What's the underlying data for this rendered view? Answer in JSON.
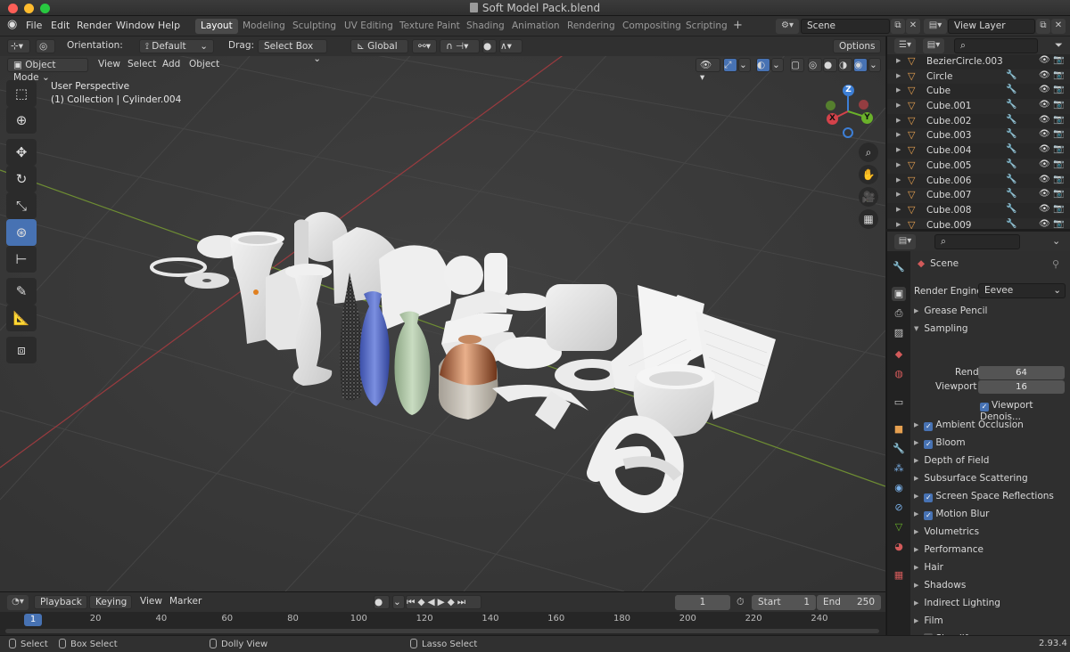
{
  "window": {
    "title": "Soft Model Pack.blend"
  },
  "menu": [
    "File",
    "Edit",
    "Render",
    "Window",
    "Help"
  ],
  "workspaces": [
    "Layout",
    "Modeling",
    "Sculpting",
    "UV Editing",
    "Texture Paint",
    "Shading",
    "Animation",
    "Rendering",
    "Compositing",
    "Scripting"
  ],
  "active_workspace": "Layout",
  "scene_field": "Scene",
  "view_layer_field": "View Layer",
  "header": {
    "orientation_label": "Orientation:",
    "orientation_value": "Default",
    "drag_label": "Drag:",
    "drag_value": "Select Box",
    "transform_orientation": "Global",
    "options_label": "Options"
  },
  "viewport_header": {
    "mode": "Object Mode",
    "menus": [
      "View",
      "Select",
      "Add",
      "Object"
    ]
  },
  "viewport": {
    "perspective": "User Perspective",
    "collection_info": "(1) Collection | Cylinder.004",
    "gizmo_axes": {
      "z": "Z",
      "x": "X",
      "y": "Y"
    },
    "colors": {
      "x_axis": "#d4424a",
      "y_axis": "#6ab12a",
      "z_axis": "#3d7fd6",
      "grid_bg": "#3a3a3a"
    }
  },
  "outliner": {
    "items": [
      {
        "name": "BezierCircle.003",
        "modifiers": false
      },
      {
        "name": "Circle",
        "modifiers": true
      },
      {
        "name": "Cube",
        "modifiers": true
      },
      {
        "name": "Cube.001",
        "modifiers": true
      },
      {
        "name": "Cube.002",
        "modifiers": true
      },
      {
        "name": "Cube.003",
        "modifiers": true
      },
      {
        "name": "Cube.004",
        "modifiers": true
      },
      {
        "name": "Cube.005",
        "modifiers": true
      },
      {
        "name": "Cube.006",
        "modifiers": true
      },
      {
        "name": "Cube.007",
        "modifiers": true
      },
      {
        "name": "Cube.008",
        "modifiers": true
      },
      {
        "name": "Cube.009",
        "modifiers": true
      }
    ]
  },
  "properties": {
    "context": "Scene",
    "render_engine_label": "Render Engine",
    "render_engine_value": "Eevee",
    "sampling": {
      "label": "Sampling",
      "render_label": "Render",
      "render_value": "64",
      "viewport_label": "Viewport",
      "viewport_value": "16",
      "denoise_label": "Viewport Denois..."
    },
    "sections": [
      {
        "label": "Grease Pencil",
        "checkbox": null
      },
      {
        "label": "Ambient Occlusion",
        "checkbox": true
      },
      {
        "label": "Bloom",
        "checkbox": true
      },
      {
        "label": "Depth of Field",
        "checkbox": null
      },
      {
        "label": "Subsurface Scattering",
        "checkbox": null
      },
      {
        "label": "Screen Space Reflections",
        "checkbox": true
      },
      {
        "label": "Motion Blur",
        "checkbox": true
      },
      {
        "label": "Volumetrics",
        "checkbox": null
      },
      {
        "label": "Performance",
        "checkbox": null
      },
      {
        "label": "Hair",
        "checkbox": null
      },
      {
        "label": "Shadows",
        "checkbox": null
      },
      {
        "label": "Indirect Lighting",
        "checkbox": null
      },
      {
        "label": "Film",
        "checkbox": null
      },
      {
        "label": "Simplify",
        "checkbox": false
      }
    ]
  },
  "timeline": {
    "menus": [
      "Playback",
      "Keying",
      "View",
      "Marker"
    ],
    "current_frame": "1",
    "start_label": "Start",
    "start_value": "1",
    "end_label": "End",
    "end_value": "250",
    "ruler_current": "1",
    "ruler_ticks": [
      "20",
      "40",
      "60",
      "80",
      "100",
      "120",
      "140",
      "160",
      "180",
      "200",
      "220",
      "240"
    ]
  },
  "statusbar": {
    "select": "Select",
    "box_select": "Box Select",
    "dolly_view": "Dolly View",
    "lasso_select": "Lasso Select",
    "version": "2.93.4"
  }
}
